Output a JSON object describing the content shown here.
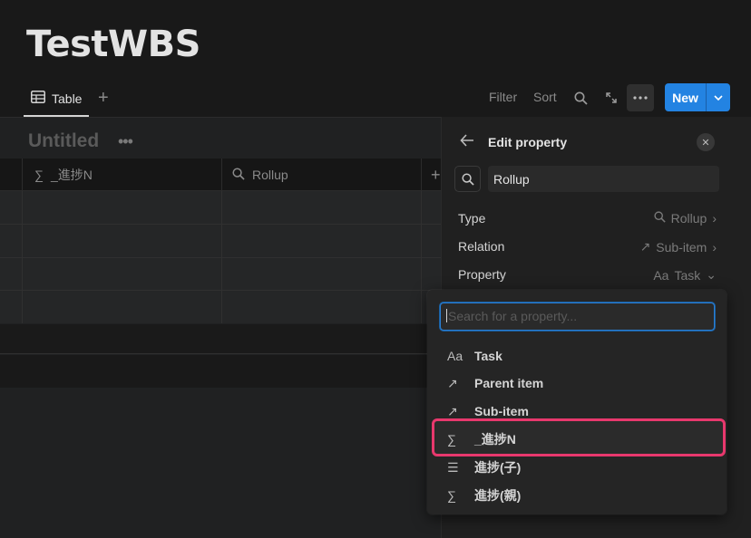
{
  "page": {
    "title": "TestWBS"
  },
  "views": {
    "tab_label": "Table",
    "toolbar": {
      "filter": "Filter",
      "sort": "Sort",
      "new_label": "New"
    }
  },
  "table": {
    "name": "Untitled",
    "columns": [
      {
        "icon": "sigma-icon",
        "label": "_進捗N"
      },
      {
        "icon": "search-icon",
        "label": "Rollup"
      }
    ]
  },
  "panel": {
    "title": "Edit property",
    "name_value": "Rollup",
    "rows": [
      {
        "label": "Type",
        "value": "Rollup",
        "icon": "search-icon"
      },
      {
        "label": "Relation",
        "value": "Sub-item",
        "icon": "arrow-up-right-icon"
      },
      {
        "label": "Property",
        "value": "Task",
        "icon_text": "Aa"
      }
    ]
  },
  "dropdown": {
    "placeholder": "Search for a property...",
    "options": [
      {
        "icon_text": "Aa",
        "label": "Task"
      },
      {
        "icon_text": "↗",
        "label": "Parent item"
      },
      {
        "icon_text": "↗",
        "label": "Sub-item"
      },
      {
        "icon_text": "∑",
        "label": "_進捗N"
      },
      {
        "icon_text": "☰",
        "label": "進捗(子)"
      },
      {
        "icon_text": "∑",
        "label": "進捗(親)"
      }
    ],
    "highlighted_index": 3
  },
  "colors": {
    "accent": "#2383e2",
    "highlight": "#e8386d",
    "background": "#191919"
  }
}
